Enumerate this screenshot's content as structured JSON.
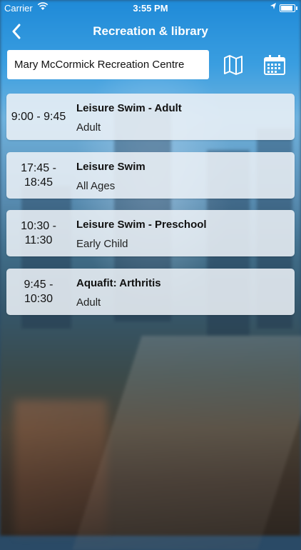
{
  "status_bar": {
    "carrier": "Carrier",
    "time": "3:55 PM",
    "wifi_icon": "wifi-icon",
    "location_icon": "location-arrow-icon",
    "battery_icon": "battery-icon"
  },
  "header": {
    "title": "Recreation & library",
    "back_icon": "chevron-left-icon"
  },
  "search": {
    "value": "Mary McCormick Recreation Centre",
    "map_icon": "map-icon",
    "calendar_icon": "calendar-icon"
  },
  "colors": {
    "nav_accent": "#1e88e5",
    "card_bg": "#ebf0f6"
  },
  "sessions": [
    {
      "time": "9:00 - 9:45",
      "name": "Leisure Swim - Adult",
      "category": "Adult"
    },
    {
      "time": "17:45 -\n18:45",
      "name": "Leisure Swim",
      "category": "All Ages"
    },
    {
      "time": "10:30 -\n11:30",
      "name": "Leisure Swim - Preschool",
      "category": "Early Child"
    },
    {
      "time": "9:45 -\n10:30",
      "name": "Aquafit: Arthritis",
      "category": "Adult"
    }
  ]
}
